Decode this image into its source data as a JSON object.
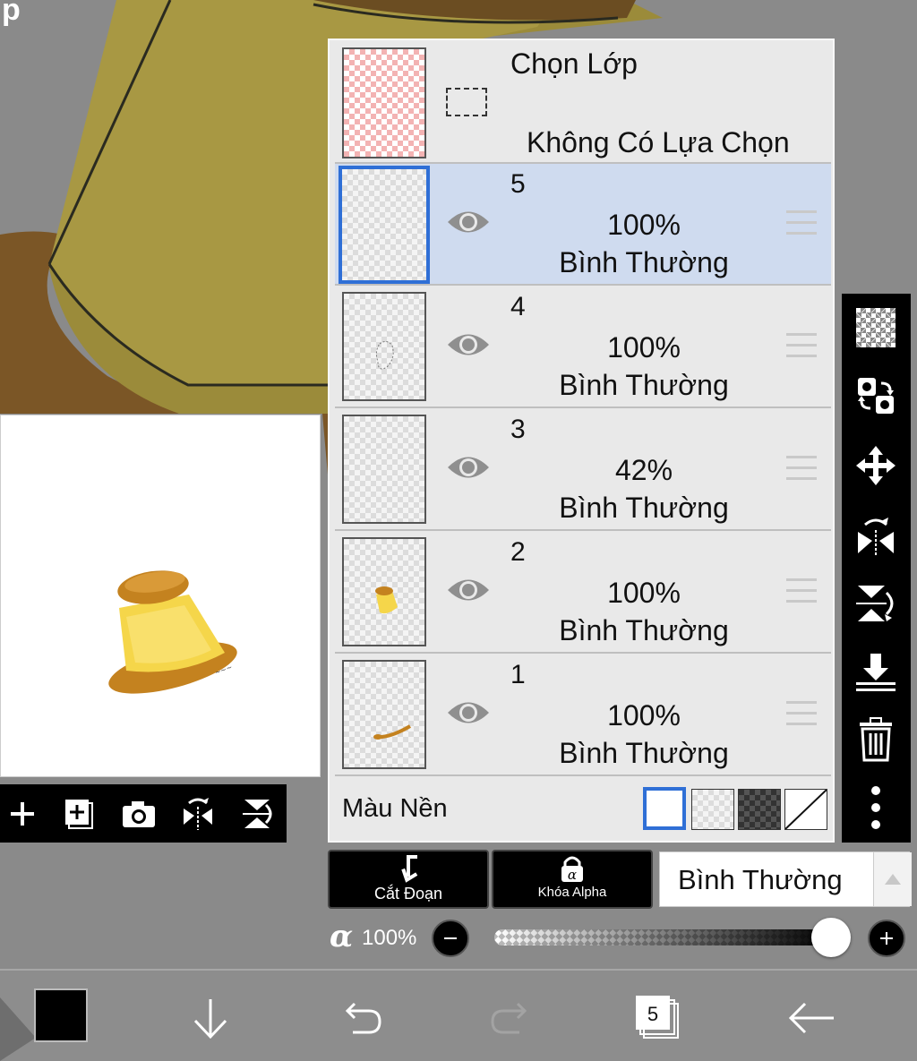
{
  "selection": {
    "title": "Chọn Lớp",
    "status": "Không Có Lựa Chọn"
  },
  "layers": [
    {
      "number": "5",
      "opacity": "100%",
      "blend": "Bình Thường",
      "selected": true
    },
    {
      "number": "4",
      "opacity": "100%",
      "blend": "Bình Thường",
      "selected": false
    },
    {
      "number": "3",
      "opacity": "42%",
      "blend": "Bình Thường",
      "selected": false
    },
    {
      "number": "2",
      "opacity": "100%",
      "blend": "Bình Thường",
      "selected": false
    },
    {
      "number": "1",
      "opacity": "100%",
      "blend": "Bình Thường",
      "selected": false
    }
  ],
  "background": {
    "label": "Màu Nền",
    "options": [
      "white",
      "transparent",
      "dark-checker",
      "none"
    ],
    "selected": "white"
  },
  "controls": {
    "clip_label": "Cắt Đoạn",
    "alpha_lock_label": "Khóa Alpha",
    "blend_mode": "Bình Thường",
    "alpha_symbol": "α",
    "opacity_value": "100%",
    "opacity_fraction": 1.0
  },
  "bottom": {
    "layer_count": "5",
    "current_color": "#000000"
  },
  "canvas": {
    "corner_letter": "p"
  },
  "colors": {
    "accent": "#2f6fd6",
    "selected_row": "#cfdbef",
    "panel": "#e9e9e9"
  }
}
